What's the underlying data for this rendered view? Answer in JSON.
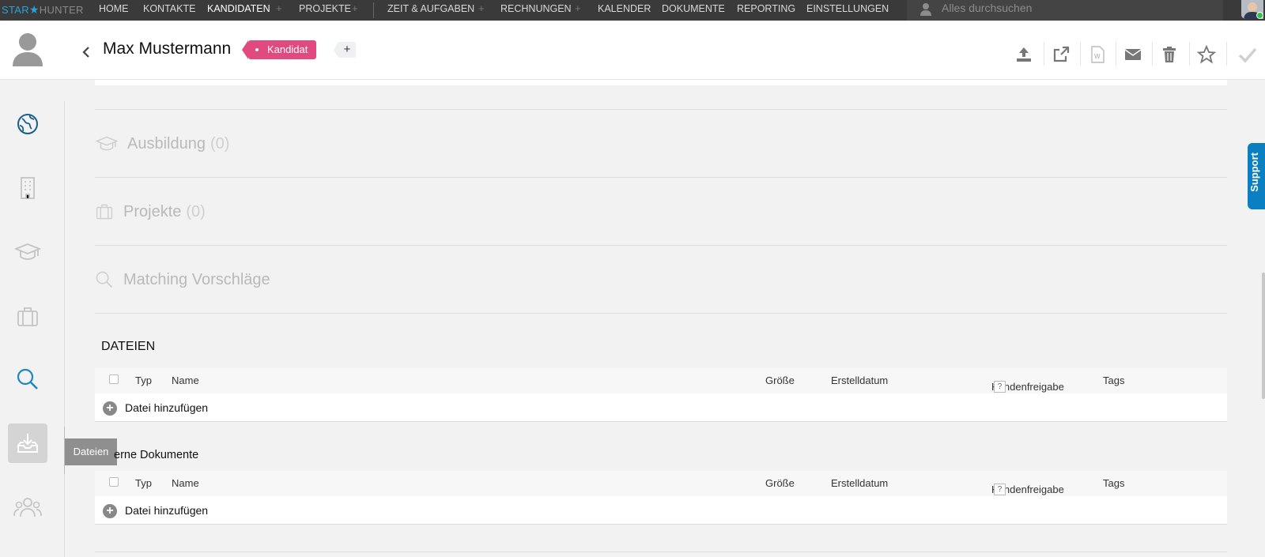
{
  "nav": {
    "logo_a": "STAR",
    "logo_b": "HUNTER",
    "items": [
      "HOME",
      "KONTAKTE",
      "KANDIDATEN",
      "PROJEKTE",
      "ZEIT & AUFGABEN",
      "RECHNUNGEN",
      "KALENDER",
      "DOKUMENTE",
      "REPORTING",
      "EINSTELLUNGEN"
    ],
    "plus": "+",
    "search_placeholder": "Alles durchsuchen"
  },
  "header": {
    "name": "Max Mustermann",
    "tag": "Kandidat",
    "tag_add": "+",
    "back_icon": "chevron-left-icon",
    "actions": [
      "upload-icon",
      "external-link-icon",
      "word-document-icon",
      "mail-icon",
      "trash-icon",
      "star-icon",
      "check-icon"
    ]
  },
  "sidebar": {
    "items": [
      "globe-icon",
      "building-icon",
      "graduation-cap-icon",
      "briefcase-icon",
      "search-icon",
      "download-tray-icon",
      "people-icon"
    ],
    "tooltip": "Dateien"
  },
  "sections": {
    "ausbildung": {
      "title": "Ausbildung",
      "count": "(0)"
    },
    "projekte": {
      "title": "Projekte",
      "count": "(0)"
    },
    "matching": {
      "title": "Matching Vorschläge"
    }
  },
  "dateien": {
    "heading": "DATEIEN",
    "columns": {
      "typ": "Typ",
      "name": "Name",
      "groesse": "Größe",
      "erstelldatum": "Erstelldatum",
      "kundenfreigabe": "Kundenfreigabe",
      "help": "?",
      "tags": "Tags"
    },
    "add_label": "Datei hinzufügen"
  },
  "externe": {
    "heading": "erne Dokumente",
    "add_label": "Datei hinzufügen"
  },
  "support": "Support",
  "colors": {
    "accent": "#2aa3d6",
    "tag": "#e04a7e",
    "topbar": "#3a3a3a",
    "support": "#0a7fc2"
  }
}
